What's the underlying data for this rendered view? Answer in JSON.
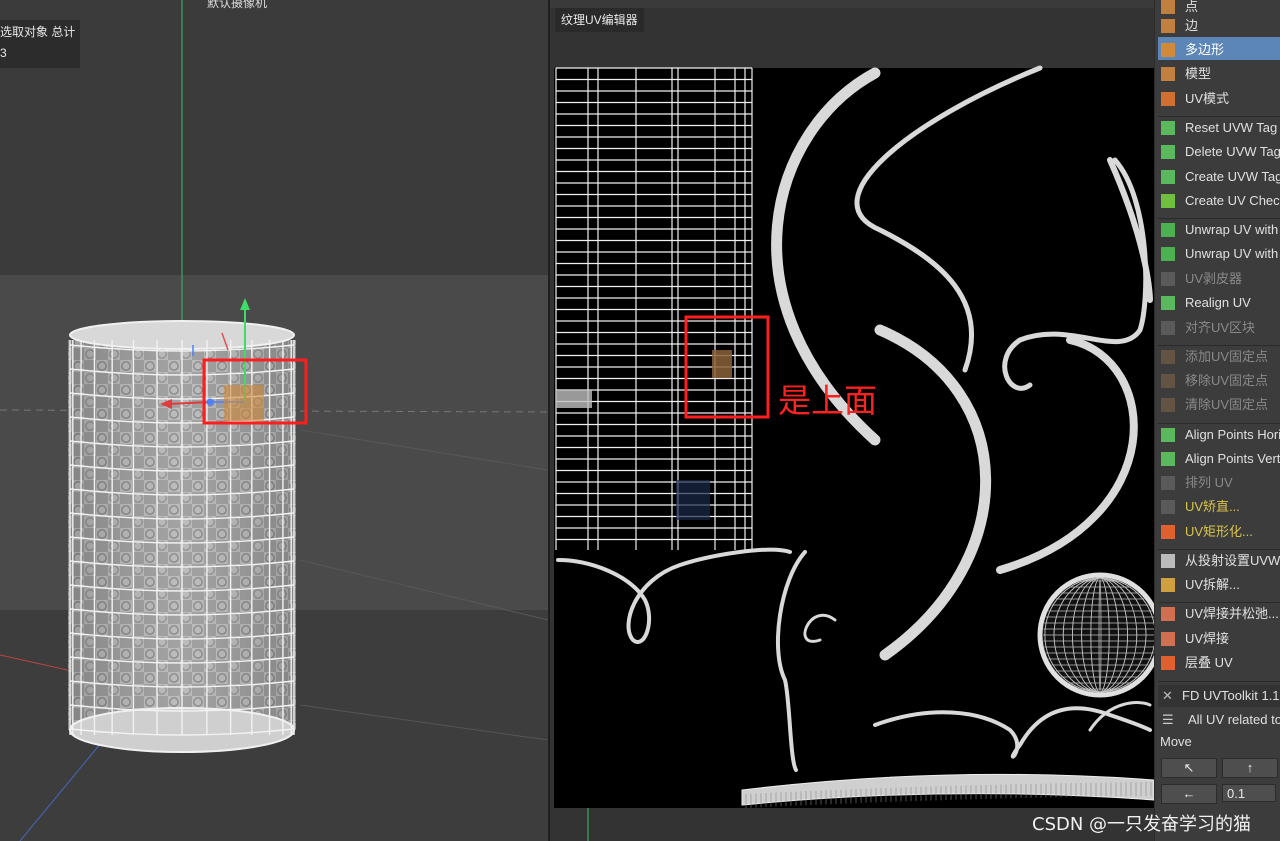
{
  "viewport": {
    "hud_label": "选取对象 总计",
    "hud_value": "3",
    "camera_label": "默认摄像机"
  },
  "uv_editor": {
    "title": "纹理UV编辑器",
    "annotation": "是上面"
  },
  "tool_panel": {
    "items": [
      {
        "label": "点",
        "icon": "point-mode-icon",
        "state": "normal"
      },
      {
        "label": "边",
        "icon": "edge-mode-icon",
        "state": "normal"
      },
      {
        "label": "多边形",
        "icon": "polygon-mode-icon",
        "state": "selected"
      },
      {
        "label": "模型",
        "icon": "model-mode-icon",
        "state": "normal"
      },
      {
        "label": "UV模式",
        "icon": "uv-mode-icon",
        "state": "normal"
      },
      {
        "label": "Reset UVW Tag",
        "icon": "checker-icon",
        "state": "normal"
      },
      {
        "label": "Delete UVW Tag",
        "icon": "checker-icon",
        "state": "normal"
      },
      {
        "label": "Create UVW Tag",
        "icon": "checker-icon",
        "state": "normal"
      },
      {
        "label": "Create UV Check",
        "icon": "sphere-icon",
        "state": "normal"
      },
      {
        "label": "Unwrap UV with LSCM",
        "icon": "lscm-icon",
        "state": "normal"
      },
      {
        "label": "Unwrap UV with ABF",
        "icon": "abf-icon",
        "state": "normal"
      },
      {
        "label": "UV剥皮器",
        "icon": "peeler-icon",
        "state": "disabled"
      },
      {
        "label": "Realign UV",
        "icon": "realign-icon",
        "state": "normal"
      },
      {
        "label": "对齐UV区块",
        "icon": "align-island-icon",
        "state": "disabled"
      },
      {
        "label": "添加UV固定点",
        "icon": "pin-add-icon",
        "state": "disabled"
      },
      {
        "label": "移除UV固定点",
        "icon": "pin-remove-icon",
        "state": "disabled"
      },
      {
        "label": "清除UV固定点",
        "icon": "pin-clear-icon",
        "state": "disabled"
      },
      {
        "label": "Align Points Horizontally",
        "icon": "align-h-icon",
        "state": "normal"
      },
      {
        "label": "Align Points Vertically",
        "icon": "align-v-icon",
        "state": "normal"
      },
      {
        "label": "排列 UV",
        "icon": "arrange-icon",
        "state": "disabled"
      },
      {
        "label": "UV矫直...",
        "icon": "straighten-icon",
        "state": "yellow-disabled"
      },
      {
        "label": "UV矩形化...",
        "icon": "rectangle-icon",
        "state": "yellow"
      },
      {
        "label": "从投射设置UVW...",
        "icon": "projection-icon",
        "state": "normal"
      },
      {
        "label": "UV拆解...",
        "icon": "unwrap-icon",
        "state": "normal"
      },
      {
        "label": "UV焊接并松弛...",
        "icon": "weld-relax-icon",
        "state": "normal"
      },
      {
        "label": "UV焊接",
        "icon": "weld-icon",
        "state": "normal"
      },
      {
        "label": "层叠 UV",
        "icon": "stack-icon",
        "state": "normal"
      }
    ],
    "plugin_title": "FD UVToolkit 1.1",
    "plugin_desc": "All UV related tools",
    "move_label": "Move",
    "move_buttons": [
      "↖",
      "↑",
      "←"
    ],
    "step_value": "0.1"
  },
  "watermark": "CSDN @一只发奋学习的猫",
  "colors": {
    "selection_blue": "#5d86b8",
    "annotation_red": "#ff2020",
    "uv_background": "#000000",
    "wire": "#e6e6e6"
  }
}
